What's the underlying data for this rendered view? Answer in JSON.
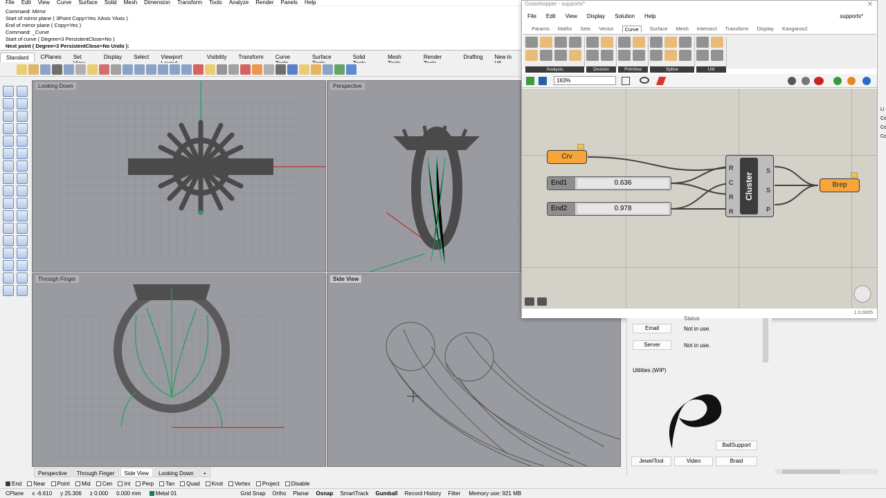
{
  "menubar": [
    "File",
    "Edit",
    "View",
    "Curve",
    "Surface",
    "Solid",
    "Mesh",
    "Dimension",
    "Transform",
    "Tools",
    "Analyze",
    "Render",
    "Panels",
    "Help"
  ],
  "command_log": [
    "Command: Mirror",
    "Start of mirror plane ( 3Point  Copy=Yes  XAxis  YAxis )",
    "End of mirror plane ( Copy=Yes )",
    "Command: _Curve",
    "Start of curve ( Degree=3  PersistentClose=No )",
    "Next point ( Degree=3  PersistentClose=No  Undo ):"
  ],
  "toolbar_tabs": [
    "Standard",
    "CPlanes",
    "Set View",
    "Display",
    "Select",
    "Viewport Layout",
    "Visibility",
    "Transform",
    "Curve Tools",
    "Surface Tools",
    "Solid Tools",
    "Mesh Tools",
    "Render Tools",
    "Drafting",
    "New in V6"
  ],
  "viewports": {
    "top_left": "Looking Down",
    "top_right": "Perspective",
    "bottom_left": "Through Finger",
    "bottom_right": "Side View"
  },
  "viewport_tabs": [
    "Perspective",
    "Through Finger",
    "Side View",
    "Looking Down",
    "+"
  ],
  "osnaps": [
    {
      "label": "End",
      "on": true
    },
    {
      "label": "Near",
      "on": false
    },
    {
      "label": "Point",
      "on": false
    },
    {
      "label": "Mid",
      "on": false
    },
    {
      "label": "Cen",
      "on": false
    },
    {
      "label": "Int",
      "on": false
    },
    {
      "label": "Perp",
      "on": false
    },
    {
      "label": "Tan",
      "on": false
    },
    {
      "label": "Quad",
      "on": false
    },
    {
      "label": "Knot",
      "on": false
    },
    {
      "label": "Vertex",
      "on": false
    },
    {
      "label": "Project",
      "on": false
    },
    {
      "label": "Disable",
      "on": false
    }
  ],
  "status": {
    "cplane": "CPlane",
    "x": "x -6.610",
    "y": "y 25.306",
    "z": "z 0.000",
    "units": "0.000 mm",
    "layer": "Metal 01",
    "toggles": [
      "Grid Snap",
      "Ortho",
      "Planar",
      "Osnap",
      "SmartTrack",
      "Gumball",
      "Record History",
      "Filter"
    ],
    "bold_toggles": [
      "Osnap",
      "Gumball"
    ],
    "memory": "Memory use: 921 MB"
  },
  "grasshopper": {
    "title": "Grasshopper - supports*",
    "doc_name": "supports*",
    "menu": [
      "File",
      "Edit",
      "View",
      "Display",
      "Solution",
      "Help"
    ],
    "tabs": [
      "Params",
      "Maths",
      "Sets",
      "Vector",
      "Curve",
      "Surface",
      "Mesh",
      "Intersect",
      "Transform",
      "Display",
      "Kangaroo2"
    ],
    "active_tab": "Curve",
    "ribbon_groups": [
      "Analysis",
      "Division",
      "Primitive",
      "Spline",
      "Util"
    ],
    "zoom": "163%",
    "nodes": {
      "crv": "Crv",
      "brep": "Brep",
      "cluster": "Cluster",
      "cluster_inputs": [
        "R",
        "C",
        "R",
        "R"
      ],
      "cluster_outputs": [
        "S",
        "S",
        "P"
      ]
    },
    "sliders": [
      {
        "name": "End1",
        "value": "0.636"
      },
      {
        "name": "End2",
        "value": "0.978"
      }
    ],
    "version": "1.0.0005"
  },
  "side_panel": {
    "status_label": "Status",
    "email_label": "Email",
    "email_status": "Not in use.",
    "server_label": "Server",
    "server_status": "Not in use.",
    "utilities_title": "Utilities (WIP)",
    "buttons": [
      "BallSupport",
      "JewelTool",
      "Video",
      "Braid"
    ]
  },
  "colors": {
    "viewport_bg": "#999ba0",
    "gh_canvas": "#d4d1c9",
    "gh_orange": "#f7a538",
    "curve_green": "#1fa060",
    "axis_red": "#c0302a"
  }
}
